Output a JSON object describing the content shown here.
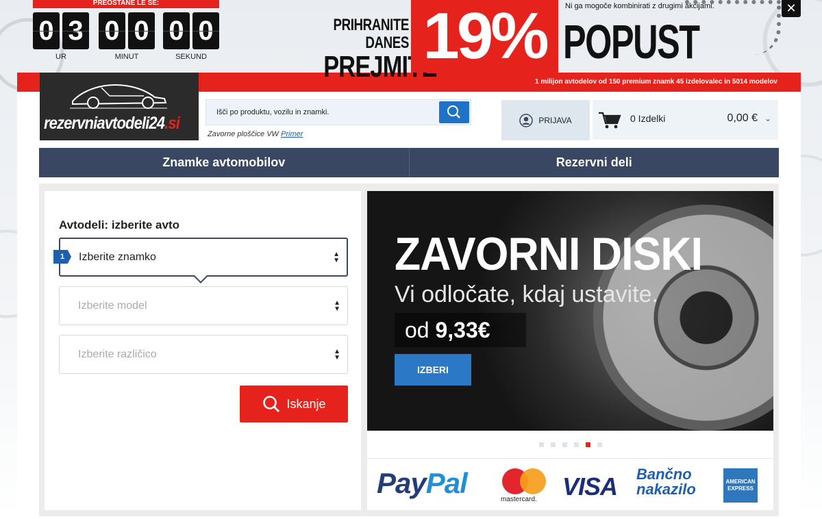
{
  "promo": {
    "timer_header": "PREOSTANE LE ŠE:",
    "hours": [
      "0",
      "3"
    ],
    "minutes": [
      "0",
      "0"
    ],
    "seconds": [
      "0",
      "0"
    ],
    "hours_label": "UR",
    "minutes_label": "MINUT",
    "seconds_label": "SEKUND",
    "headline_line1": "PRIHRANITE DANES",
    "headline_line2": "PREJMITE",
    "percent": "19%",
    "popust": "POPUST",
    "note": "Ni ga mogoče kombinirati z drugimi akcijami.",
    "close_label": "✕"
  },
  "header": {
    "tagline": "1 milijon avtodelov od 150 premium znamk 45 izdelovalec in 5014 modelov",
    "logo_text_main": "rezervniavtodeli24",
    "logo_text_accent": ".si",
    "search_placeholder": "Išči po produktu, vozilu in znamki.",
    "search_hint": "Zavorne ploščice VW",
    "search_hint_link": "Primer",
    "login_label": "PRIJAVA",
    "cart_count": "0 Izdelki",
    "cart_total": "0,00 €"
  },
  "nav": {
    "items": [
      {
        "label": "Znamke avtomobilov"
      },
      {
        "label": "Rezervni deli"
      }
    ]
  },
  "selector": {
    "title": "Avtodeli: izberite avto",
    "step": "1",
    "brand_placeholder": "Izberite znamko",
    "model_placeholder": "Izberite model",
    "variant_placeholder": "Izberite različico",
    "search_button": "Iskanje"
  },
  "banner": {
    "title": "ZAVORNI DISKI",
    "subtitle": "Vi odločate, kdaj ustavite.",
    "price_prefix": "od",
    "price": "9,33€",
    "button": "IZBERI",
    "active_slide": 5
  },
  "payments": {
    "paypal_1": "Pay",
    "paypal_2": "Pal",
    "mastercard": "mastercard.",
    "visa": "VISA",
    "bank_line1": "Bančno",
    "bank_line2": "nakazilo",
    "amex_line1": "AMERICAN",
    "amex_line2": "EXPRESS"
  },
  "colors": {
    "red": "#e5231c",
    "navy": "#3a4762",
    "blue": "#1f73c6"
  }
}
